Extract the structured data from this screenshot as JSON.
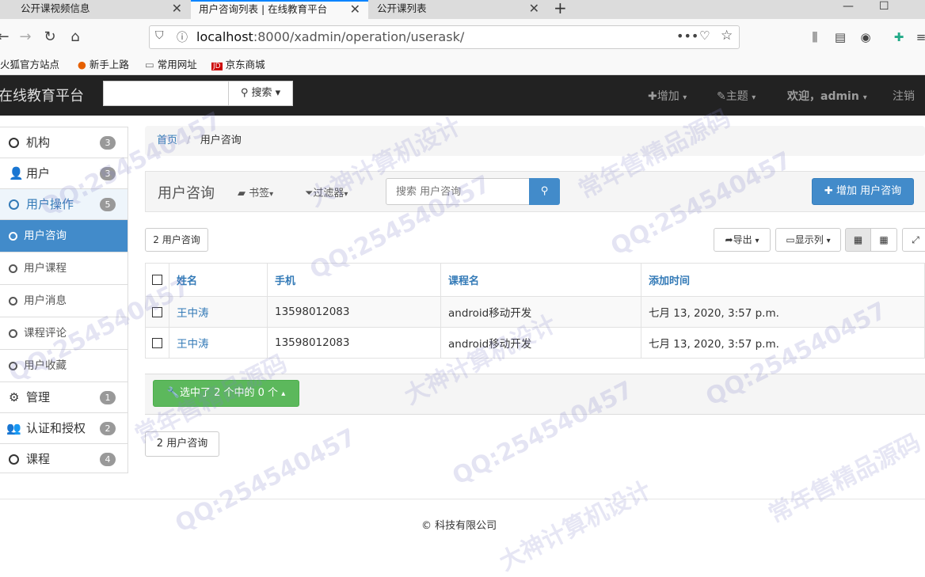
{
  "browser": {
    "tabs": [
      {
        "label": "公开课视频信息",
        "active": false
      },
      {
        "label": "用户咨询列表 | 在线教育平台",
        "active": true
      },
      {
        "label": "公开课列表",
        "active": false
      }
    ],
    "url_host": "localhost",
    "url_path": ":8000/xadmin/operation/userask/",
    "bookmarks": [
      "火狐官方站点",
      "新手上路",
      "常用网址",
      "京东商城"
    ]
  },
  "header": {
    "brand": "在线教育平台",
    "search_label": "搜索",
    "add_label": "增加",
    "theme_label": "主题",
    "welcome_label": "欢迎，admin",
    "logout_label": "注销"
  },
  "sidebar": {
    "items": [
      {
        "label": "机构",
        "badge": "3"
      },
      {
        "label": "用户",
        "badge": "3"
      },
      {
        "label": "用户操作",
        "badge": "5"
      },
      {
        "label": "用户咨询"
      },
      {
        "label": "用户课程"
      },
      {
        "label": "用户消息"
      },
      {
        "label": "课程评论"
      },
      {
        "label": "用户收藏"
      },
      {
        "label": "管理",
        "badge": "1"
      },
      {
        "label": "认证和授权",
        "badge": "2"
      },
      {
        "label": "课程",
        "badge": "4"
      }
    ]
  },
  "breadcrumb": {
    "home": "首页",
    "current": "用户咨询"
  },
  "panel": {
    "title": "用户咨询",
    "bookmarks_label": "书签",
    "filter_label": "过滤器",
    "search_placeholder": "搜索 用户咨询",
    "add_button": "增加 用户咨询"
  },
  "toolbar": {
    "count_label": "2 用户咨询",
    "export_label": "导出",
    "columns_label": "显示列"
  },
  "table": {
    "headers": [
      "姓名",
      "手机",
      "课程名",
      "添加时间"
    ],
    "rows": [
      [
        "王中涛",
        "13598012083",
        "android移动开发",
        "七月 13, 2020, 3:57 p.m."
      ],
      [
        "王中涛",
        "13598012083",
        "android移动开发",
        "七月 13, 2020, 3:57 p.m."
      ]
    ]
  },
  "actions": {
    "selected_label": "选中了 2 个中的 0 个"
  },
  "footer": {
    "count_label": "2 用户咨询",
    "copyright": "© 科技有限公司"
  },
  "watermarks": [
    "QQ:254540457",
    "常年售精品源码",
    "大神计算机设计"
  ],
  "colors": {
    "primary": "#428bca",
    "success": "#5cb85c",
    "header_bg": "#222222"
  }
}
